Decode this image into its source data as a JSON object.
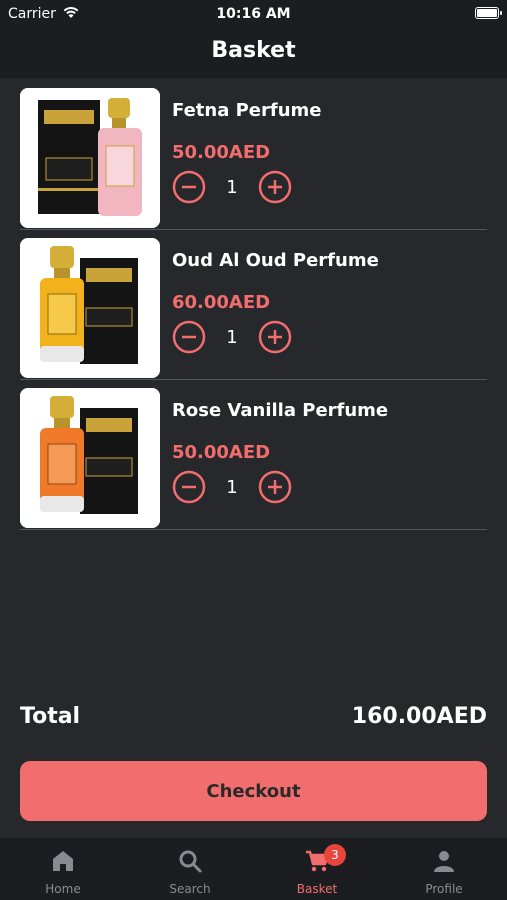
{
  "status_bar": {
    "carrier": "Carrier",
    "time": "10:16 AM"
  },
  "header": {
    "title": "Basket"
  },
  "items": [
    {
      "name": "Fetna Perfume",
      "price": "50.00AED",
      "quantity": "1"
    },
    {
      "name": "Oud Al Oud Perfume",
      "price": "60.00AED",
      "quantity": "1"
    },
    {
      "name": "Rose Vanilla Perfume",
      "price": "50.00AED",
      "quantity": "1"
    }
  ],
  "summary": {
    "total_label": "Total",
    "total_value": "160.00AED"
  },
  "checkout_label": "Checkout",
  "tabs": [
    {
      "label": "Home",
      "icon": "home-icon",
      "active": false
    },
    {
      "label": "Search",
      "icon": "search-icon",
      "active": false
    },
    {
      "label": "Basket",
      "icon": "cart-icon",
      "active": true,
      "badge": "3"
    },
    {
      "label": "Profile",
      "icon": "person-icon",
      "active": false
    }
  ],
  "colors": {
    "accent": "#f26d6d",
    "background": "#27282c",
    "bar": "#1c1d20",
    "badge": "#e8453c"
  }
}
